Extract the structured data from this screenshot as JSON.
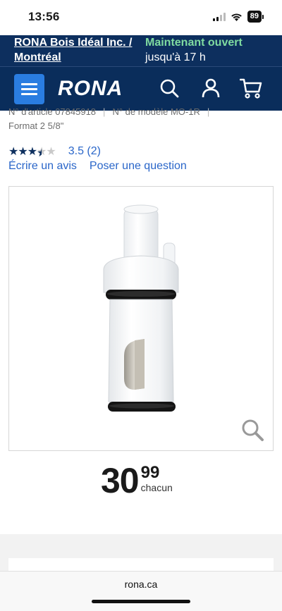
{
  "status": {
    "time": "13:56",
    "battery": "89"
  },
  "store": {
    "name": "RONA Bois Idéal Inc. / Montréal",
    "open_status": "Maintenant ouvert",
    "hours": "jusqu'à 17 h"
  },
  "header": {
    "logo": "RONA",
    "icons": [
      "menu-icon",
      "search-icon",
      "account-icon",
      "cart-icon"
    ]
  },
  "product": {
    "article_number": "N° d'article 07845918",
    "model_number": "N° de modèle MO-1R",
    "format": "Format 2 5/8\"",
    "rating_value": "3.5",
    "rating_count": "(2)",
    "rating_stars": 3.5,
    "write_review": "Écrire un avis",
    "ask_question": "Poser une question"
  },
  "price": {
    "dollars": "30",
    "cents": "99",
    "unit": "chacun"
  },
  "browser": {
    "url": "rona.ca"
  },
  "colors": {
    "navy": "#0a2d5b",
    "accent_blue": "#2a7de1",
    "open_green": "#7fdba0",
    "link_blue": "#2a66c9"
  }
}
